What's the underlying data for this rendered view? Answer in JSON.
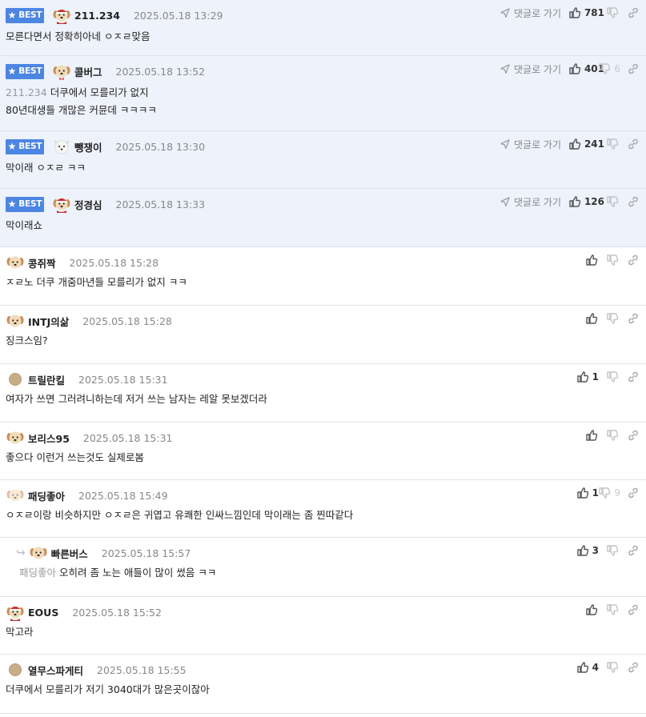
{
  "labels": {
    "best_badge": "BEST",
    "goto_reply": "댓글로 가기"
  },
  "colors": {
    "best_bg": "#edf2fb",
    "badge_bg": "#4d86e2",
    "divider": "#dfe3ea"
  },
  "comments": [
    {
      "best": true,
      "avatar": "santa-puppy",
      "nick": "211.234",
      "time": "2025.05.18 13:29",
      "lines": [
        "모른다면서 정확히아네 ㅇㅈㄹ맞음"
      ],
      "likes": "781",
      "dislikes": "",
      "mention": ""
    },
    {
      "best": true,
      "avatar": "puppy-bowtie",
      "nick": "콜버그",
      "time": "2025.05.18 13:52",
      "lines": [
        "더쿠에서 모를리가 없지",
        "80년대생들 개많은 커뮨데 ㅋㅋㅋㅋ"
      ],
      "likes": "401",
      "dislikes": "6",
      "mention": "211.234"
    },
    {
      "best": true,
      "avatar": "white-dog",
      "nick": "뺑쟁이",
      "time": "2025.05.18 13:30",
      "lines": [
        "막이래 ㅇㅈㄹ ㅋㅋ"
      ],
      "likes": "241",
      "dislikes": "",
      "mention": ""
    },
    {
      "best": true,
      "avatar": "santa-puppy",
      "nick": "정경심",
      "time": "2025.05.18 13:33",
      "lines": [
        "막이래쇼"
      ],
      "likes": "126",
      "dislikes": "",
      "mention": ""
    },
    {
      "best": false,
      "avatar": "puppy",
      "nick": "콩쥐짝",
      "time": "2025.05.18 15:28",
      "lines": [
        "ㅈㄹ노 더쿠 개줌마년들 모를리가 없지 ㅋㅋ"
      ],
      "likes": "",
      "dislikes": "",
      "mention": ""
    },
    {
      "best": false,
      "avatar": "puppy",
      "nick": "INTJ의삶",
      "time": "2025.05.18 15:28",
      "lines": [
        "징크스임?"
      ],
      "likes": "",
      "dislikes": "",
      "mention": ""
    },
    {
      "best": false,
      "avatar": "default-circle",
      "nick": "트릴란킬",
      "time": "2025.05.18 15:31",
      "lines": [
        "여자가 쓰면 그러려니하는데 저거 쓰는 남자는 레알 못보겠더라"
      ],
      "likes": "1",
      "dislikes": "",
      "mention": ""
    },
    {
      "best": false,
      "avatar": "puppy",
      "nick": "보리스95",
      "time": "2025.05.18 15:31",
      "lines": [
        "좋으다 이런거 쓰는것도 실제로봄"
      ],
      "likes": "",
      "dislikes": "",
      "mention": ""
    },
    {
      "best": false,
      "avatar": "blurred-puppy",
      "nick": "패딩좋아",
      "time": "2025.05.18 15:49",
      "lines": [
        "ㅇㅈㄹ이랑 비슷하지만 ㅇㅈㄹ은 귀엽고 유쾌한 인싸느낌인데 막이래는 좀 찐따같다"
      ],
      "likes": "1",
      "dislikes": "9",
      "mention": ""
    },
    {
      "best": false,
      "reply": true,
      "avatar": "puppy",
      "nick": "빠른버스",
      "time": "2025.05.18 15:57",
      "lines": [
        "오히려 좀 노는 애들이 많이 썼음 ㅋㅋ"
      ],
      "likes": "3",
      "dislikes": "",
      "mention": "패딩좋아"
    },
    {
      "best": false,
      "avatar": "santa-puppy",
      "nick": "EOUS",
      "time": "2025.05.18 15:52",
      "lines": [
        "막고라"
      ],
      "likes": "",
      "dislikes": "",
      "mention": ""
    },
    {
      "best": false,
      "avatar": "default-circle",
      "nick": "열무스파게티",
      "time": "2025.05.18 15:55",
      "lines": [
        "더쿠에서 모를리가 저기 3040대가 많은곳이잖아"
      ],
      "likes": "4",
      "dislikes": "",
      "mention": ""
    }
  ]
}
